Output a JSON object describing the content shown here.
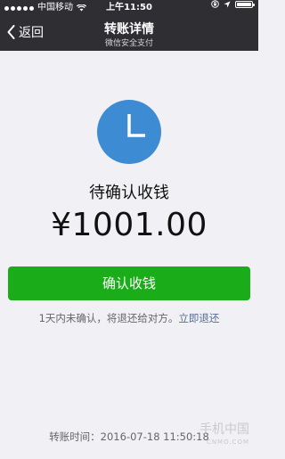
{
  "status_bar": {
    "carrier": "中国移动",
    "time": "上午11:50"
  },
  "nav": {
    "back_label": "返回",
    "title": "转账详情",
    "subtitle": "微信安全支付"
  },
  "transfer": {
    "status": "待确认收钱",
    "amount": "¥1001.00",
    "confirm_label": "确认收钱",
    "hint_text": "1天内未确认，将退还给对方。",
    "refund_link": "立即退还",
    "time_label": "转账时间：",
    "time_value": "2016-07-18 11:50:18"
  },
  "watermark": {
    "main": "手机中国",
    "sub": "CNMO.COM"
  },
  "colors": {
    "nav_bg": "#2e2e33",
    "page_bg": "#f1f1f5",
    "clock_blue": "#3d8bd2",
    "button_green": "#1aad19",
    "link_blue": "#576b95"
  },
  "icons": {
    "signal": "signal-dots-icon",
    "wifi": "wifi-icon",
    "lock": "orientation-lock-icon",
    "location": "location-arrow-icon",
    "battery": "battery-icon",
    "back": "chevron-left-icon",
    "clock": "clock-icon"
  }
}
